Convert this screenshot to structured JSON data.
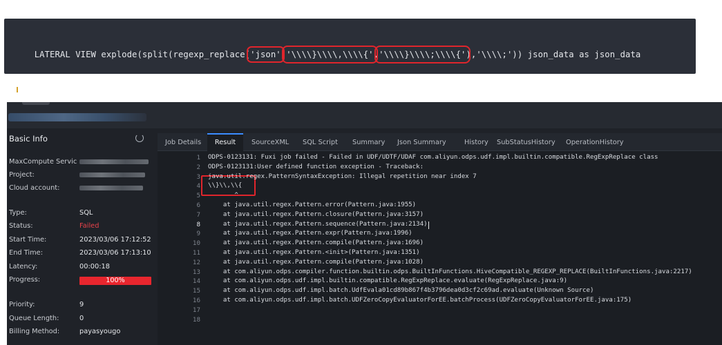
{
  "snippet": {
    "parts": [
      {
        "text": "LATERAL VIEW explode(split(regexp_replace(",
        "hl": false
      },
      {
        "text": "'json'",
        "hl": true
      },
      {
        "text": ",",
        "hl": false
      },
      {
        "text": "'\\\\\\\\}\\\\\\\\,\\\\\\\\{'",
        "hl": true
      },
      {
        "text": ",",
        "hl": false
      },
      {
        "text": "'\\\\\\\\}\\\\\\\\;\\\\\\\\{'",
        "hl": true
      },
      {
        "text": "),'\\\\\\\\;')) json_data as json_data",
        "hl": false
      }
    ]
  },
  "info": {
    "title": "Basic Info",
    "labels": {
      "service": "MaxCompute Servic",
      "project": "Project:",
      "cloud_account": "Cloud account:",
      "type": "Type:",
      "status": "Status:",
      "start_time": "Start Time:",
      "end_time": "End Time:",
      "latency": "Latency:",
      "progress": "Progress:",
      "priority": "Priority:",
      "queue_length": "Queue Length:",
      "billing_method": "Billing Method:"
    },
    "values": {
      "type": "SQL",
      "status": "Failed",
      "start_time": "2023/03/06 17:12:52",
      "end_time": "2023/03/06 17:13:10",
      "latency": "00:00:18",
      "progress_text": "100%",
      "progress": 1.0,
      "priority": "9",
      "queue_length": "0",
      "billing_method": "payasyougo"
    },
    "status_color": "#e8424a",
    "progress_color": "#e8262e"
  },
  "tabs": [
    "Job Details",
    "Result",
    "SourceXML",
    "SQL Script",
    "Summary",
    "Json Summary",
    "History",
    "SubStatusHistory",
    "OperationHistory"
  ],
  "active_tab": "Result",
  "result_lines": [
    "ODPS-0123131: Fuxi job failed - Failed in UDF/UDTF/UDAF com.aliyun.odps.udf.impl.builtin.compatible.RegExpReplace class",
    "ODPS-0123131:User defined function exception - Traceback:",
    "java.util.regex.PatternSyntaxException: Illegal repetition near index 7",
    "\\\\}\\\\,\\\\{",
    "       ^",
    "    at java.util.regex.Pattern.error(Pattern.java:1955)",
    "    at java.util.regex.Pattern.closure(Pattern.java:3157)",
    "    at java.util.regex.Pattern.sequence(Pattern.java:2134)",
    "    at java.util.regex.Pattern.expr(Pattern.java:1996)",
    "    at java.util.regex.Pattern.compile(Pattern.java:1696)",
    "    at java.util.regex.Pattern.<init>(Pattern.java:1351)",
    "    at java.util.regex.Pattern.compile(Pattern.java:1028)",
    "    at com.aliyun.odps.compiler.function.builtin.odps.BuiltInFunctions.HiveCompatible_REGEXP_REPLACE(BuiltInFunctions.java:2217)",
    "    at com.aliyun.odps.udf.impl.builtin.compatible.RegExpReplace.evaluate(RegExpReplace.java:9)",
    "    at com.aliyun.odps.udf.impl.batch.UdfEvala01cd89b867f4b3796dea0d3cf2c69ad.evaluate(Unknown Source)",
    "    at com.aliyun.odps.udf.impl.batch.UDFZeroCopyEvaluatorForEE.batchProcess(UDFZeroCopyEvaluatorForEE.java:175)",
    "",
    ""
  ],
  "current_line": 8,
  "highlight_color": "#e0252c",
  "active_tab_color": "#3b8cff"
}
